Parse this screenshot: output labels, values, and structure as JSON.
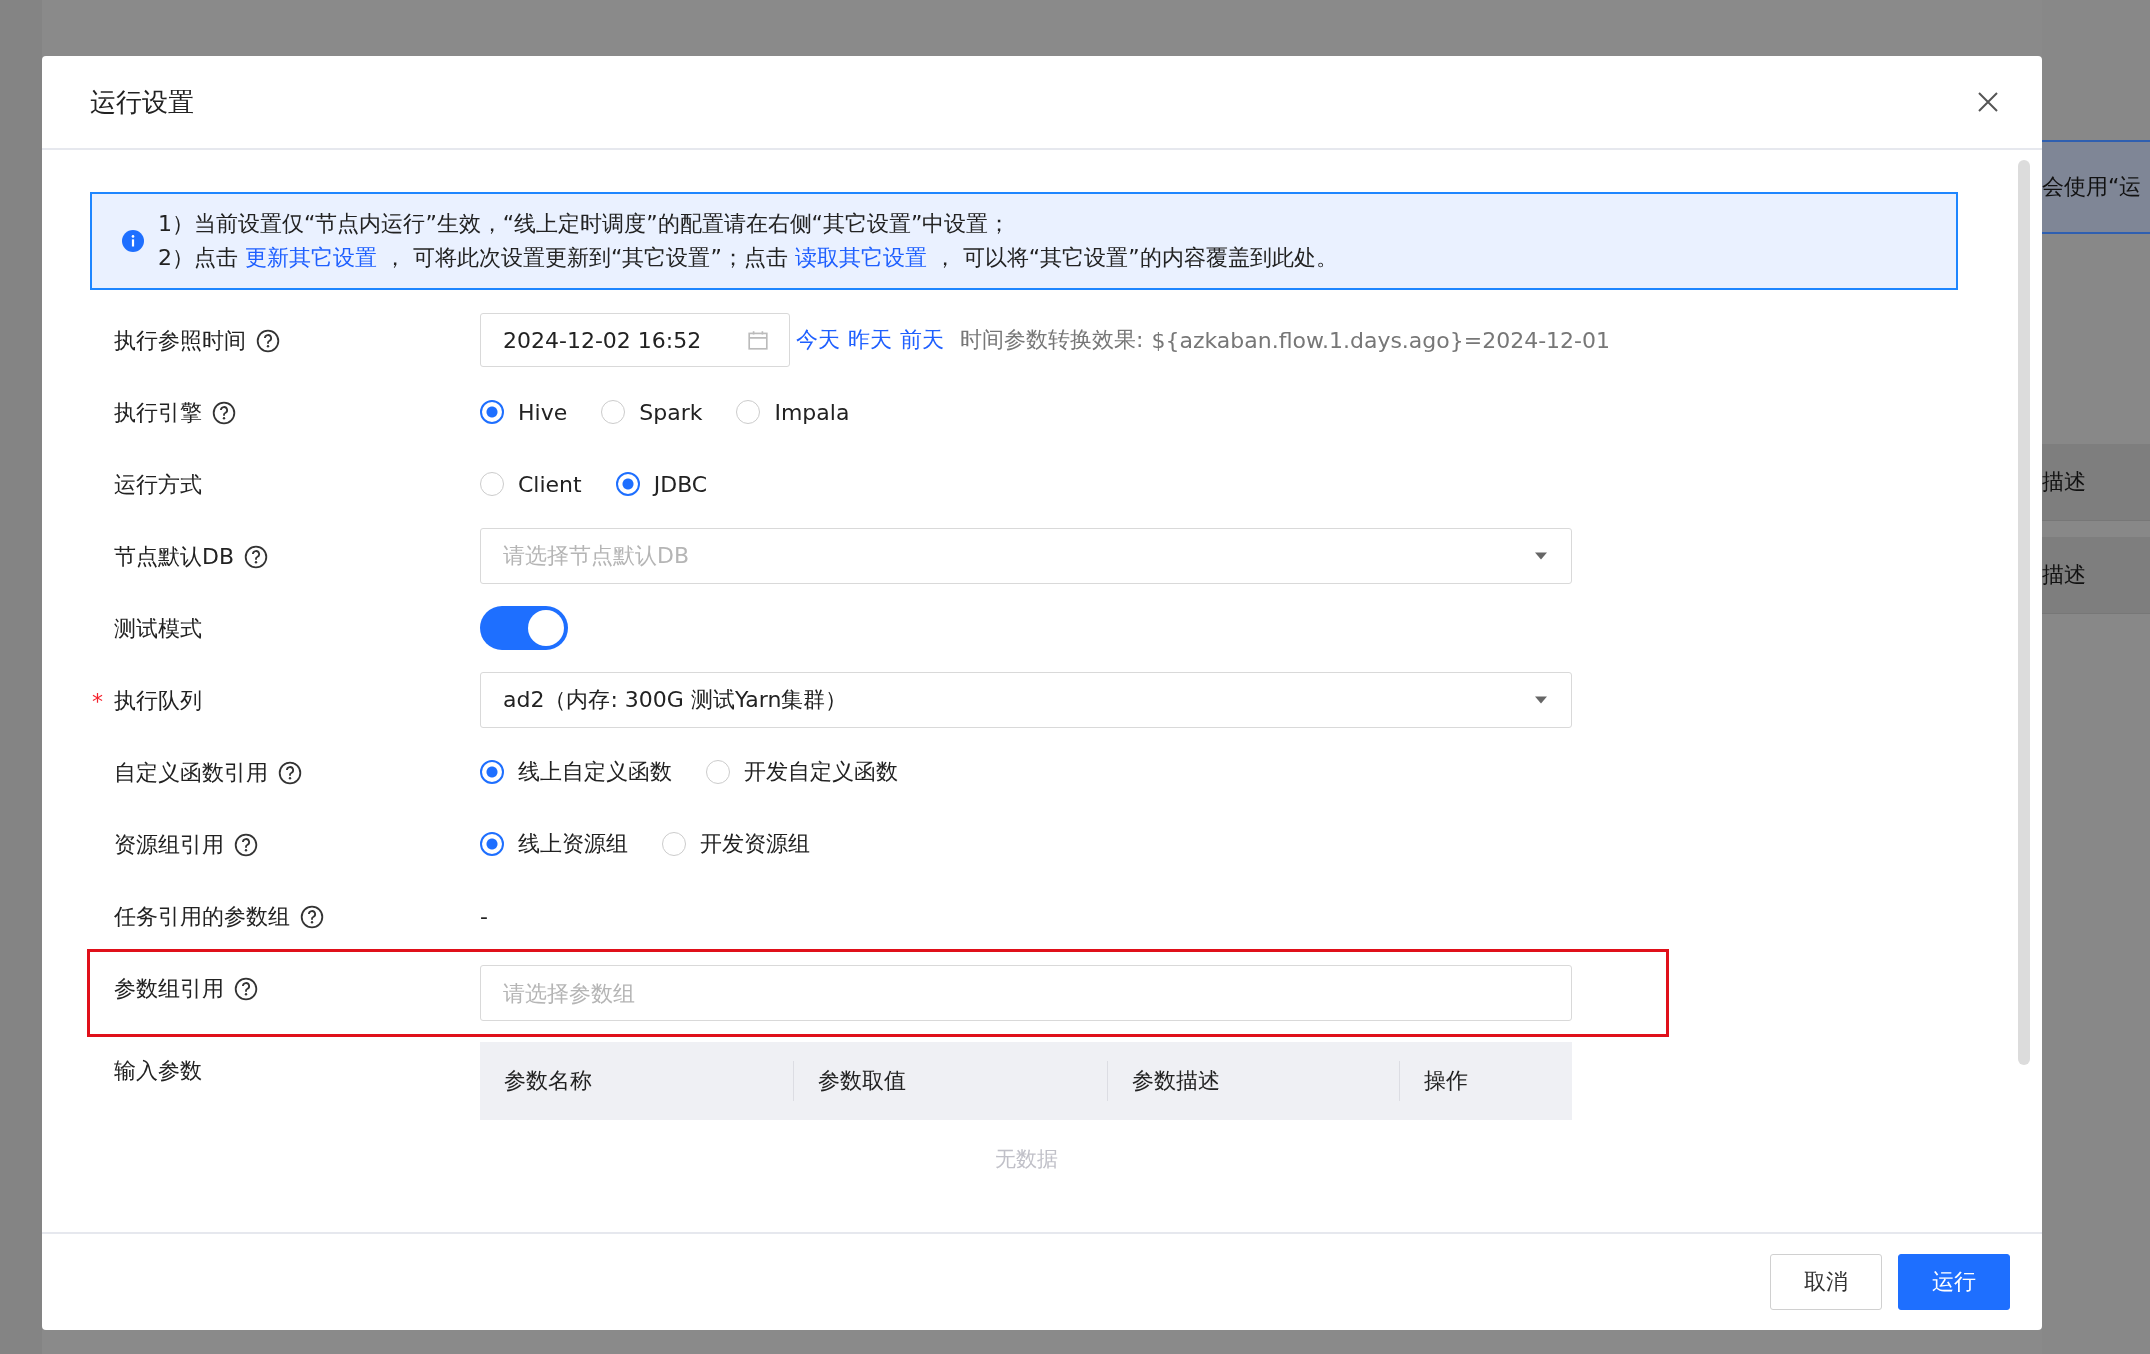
{
  "background": {
    "notice": "会使用“运",
    "rows": [
      "描述",
      "描述"
    ]
  },
  "dialog": {
    "title": "运行设置",
    "info": [
      [
        {
          "kind": "text",
          "text": "1）当前设置仅“节点内运行”生效，“线上定时调度”的配置请在右侧“其它设置”中设置；"
        }
      ],
      [
        {
          "kind": "text",
          "text": "2）点击 "
        },
        {
          "kind": "link",
          "text": "更新其它设置"
        },
        {
          "kind": "text",
          "text": " ， 可将此次设置更新到“其它设置”；点击 "
        },
        {
          "kind": "link",
          "text": "读取其它设置"
        },
        {
          "kind": "text",
          "text": " ， 可以将“其它设置”的内容覆盖到此处。"
        }
      ]
    ],
    "fields": [
      {
        "kind": "date",
        "label": "执行参照时间",
        "help": true,
        "value": "2024-12-02 16:52",
        "shortcuts": [
          "今天",
          "昨天",
          "前天"
        ],
        "hint_label": "时间参数转换效果:",
        "hint_value": "${azkaban.flow.1.days.ago}=2024-12-01"
      },
      {
        "kind": "radio",
        "label": "执行引擎",
        "help": true,
        "options": [
          {
            "label": "Hive",
            "selected": true
          },
          {
            "label": "Spark",
            "selected": false
          },
          {
            "label": "Impala",
            "selected": false
          }
        ]
      },
      {
        "kind": "radio",
        "label": "运行方式",
        "help": false,
        "options": [
          {
            "label": "Client",
            "selected": false
          },
          {
            "label": "JDBC",
            "selected": true
          }
        ]
      },
      {
        "kind": "select",
        "label": "节点默认DB",
        "help": true,
        "placeholder": "请选择节点默认DB"
      },
      {
        "kind": "switch",
        "label": "测试模式",
        "help": false,
        "on": true
      },
      {
        "kind": "select",
        "label": "执行队列",
        "help": false,
        "required_mark": "*",
        "value": "ad2（内存: 300G 测试Yarn集群）"
      },
      {
        "kind": "radio",
        "label": "自定义函数引用",
        "help": true,
        "options": [
          {
            "label": "线上自定义函数",
            "selected": true
          },
          {
            "label": "开发自定义函数",
            "selected": false
          }
        ]
      },
      {
        "kind": "radio",
        "label": "资源组引用",
        "help": true,
        "options": [
          {
            "label": "线上资源组",
            "selected": true
          },
          {
            "label": "开发资源组",
            "selected": false
          }
        ]
      },
      {
        "kind": "text",
        "label": "任务引用的参数组",
        "help": true,
        "value": "-"
      },
      {
        "kind": "input",
        "label": "参数组引用",
        "help": true,
        "placeholder": "请选择参数组",
        "highlighted": true
      },
      {
        "kind": "table",
        "label": "输入参数",
        "help": false,
        "columns": [
          "参数名称",
          "参数取值",
          "参数描述",
          "操作"
        ],
        "empty": "无数据"
      }
    ],
    "buttons": [
      {
        "label": "取消",
        "primary": false
      },
      {
        "label": "运行",
        "primary": true
      }
    ]
  }
}
